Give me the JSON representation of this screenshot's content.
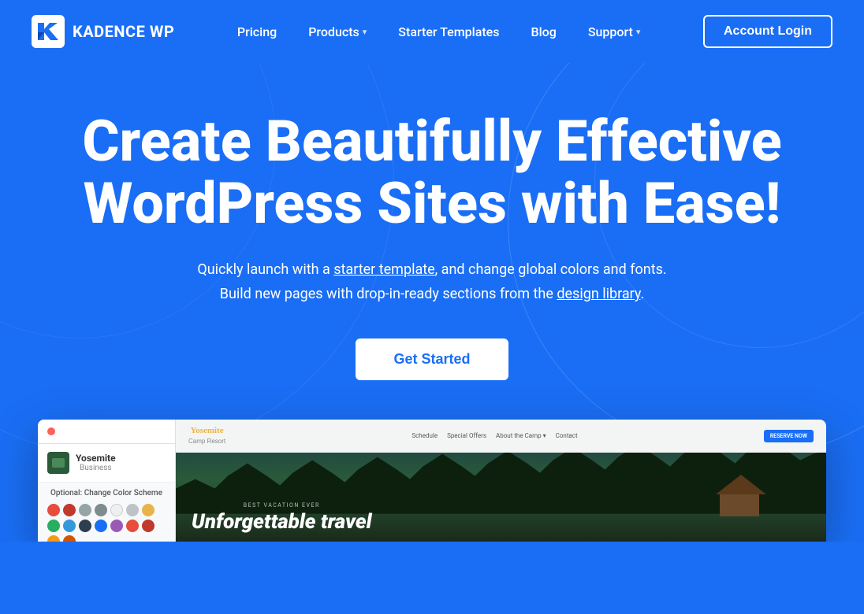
{
  "brand": {
    "name": "KADENCE WP",
    "logo_alt": "Kadence WP Logo"
  },
  "nav": {
    "items": [
      {
        "label": "Pricing",
        "has_dropdown": false
      },
      {
        "label": "Products",
        "has_dropdown": true
      },
      {
        "label": "Starter Templates",
        "has_dropdown": false
      },
      {
        "label": "Blog",
        "has_dropdown": false
      },
      {
        "label": "Support",
        "has_dropdown": true
      }
    ],
    "account_login": "Account Login"
  },
  "hero": {
    "title": "Create Beautifully Effective WordPress Sites with Ease!",
    "subtitle_before": "Quickly launch with a ",
    "subtitle_link1": "starter template",
    "subtitle_middle": ", and change global colors and fonts.",
    "subtitle_line2_before": "Build new pages with drop-in-ready sections from the ",
    "subtitle_link2": "design library",
    "subtitle_after": ".",
    "cta_button": "Get Started"
  },
  "preview": {
    "site_name": "Yosemite",
    "site_type": "Business",
    "color_label": "Optional: Change Color Scheme",
    "swatches": [
      "#e74c3c",
      "#c0392b",
      "#1a6ef5",
      "#2c3e50",
      "#95a5a6",
      "#bdc3c7",
      "#ecf0f1",
      "#e8b44a",
      "#27ae60",
      "#2ecc71",
      "#3498db",
      "#9b59b6",
      "#e74c3c",
      "#c0392b",
      "#f39c12",
      "#d35400"
    ],
    "preview_logo": "Yosemite\nCamp Resort",
    "preview_nav": [
      "Schedule",
      "Special Offers",
      "About the Camp ▾",
      "Contact"
    ],
    "preview_cta": "RESERVE NOW",
    "preview_tagline": "BEST VACATION EVER",
    "preview_title": "Unforgettable travel"
  },
  "colors": {
    "primary_blue": "#1a6ef5",
    "white": "#ffffff",
    "nav_hover": "rgba(255,255,255,0.1)"
  }
}
